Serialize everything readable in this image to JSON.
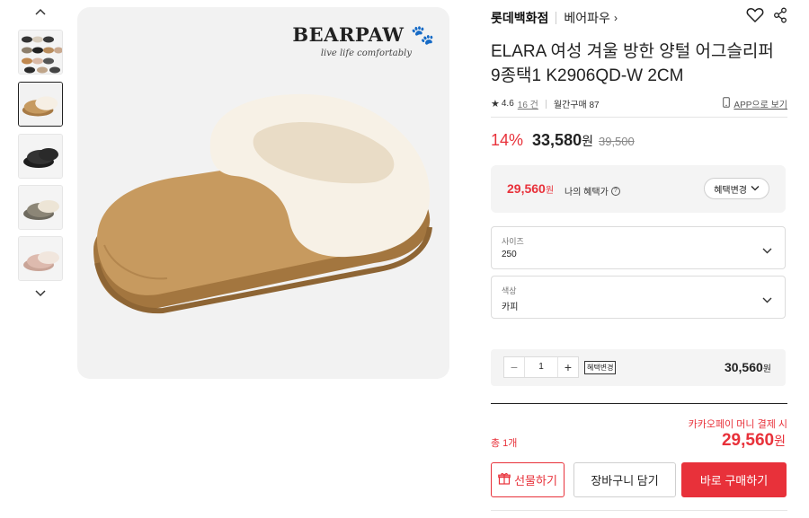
{
  "gallery": {
    "thumbnails": [
      {
        "alt": "all colors",
        "selected": false
      },
      {
        "alt": "chestnut",
        "selected": true
      },
      {
        "alt": "black",
        "selected": false
      },
      {
        "alt": "grey",
        "selected": false
      },
      {
        "alt": "pink",
        "selected": false
      }
    ],
    "main_logo": "BEARPAW",
    "main_logo_sub": "live life comfortably"
  },
  "header": {
    "store": "롯데백화점",
    "brand": "베어파우",
    "brand_arrow": "›"
  },
  "product": {
    "title": "ELARA 여성 겨울 방한 양털 어그슬리퍼 9종택1 K2906QD-W 2CM",
    "rating": "4.6",
    "reviews": "16 건",
    "monthly": "월간구매 87",
    "app_link": "APP으로 보기",
    "star": "★"
  },
  "pricing": {
    "discount": "14%",
    "price": "33,580",
    "won": "원",
    "original": "39,500",
    "benefit_price": "29,560",
    "benefit_unit": "원",
    "benefit_label": "나의 혜택가",
    "benefit_button": "혜택변경"
  },
  "options": [
    {
      "label": "사이즈",
      "value": "250"
    },
    {
      "label": "색상",
      "value": "카피"
    }
  ],
  "quantity": {
    "minus": "−",
    "value": "1",
    "plus": "+",
    "benefit_tag": "혜택변경",
    "line_price": "30,560",
    "line_unit": "원"
  },
  "total": {
    "kakao_note": "카카오페이 머니 결제 시",
    "count": "총 1개",
    "price": "29,560",
    "unit": "원"
  },
  "actions": {
    "gift": "선물하기",
    "cart": "장바구니 담기",
    "buy": "바로 구매하기"
  },
  "colors": {
    "accent": "#e8313a",
    "text": "#222222",
    "box_bg": "#f4f4f4"
  }
}
